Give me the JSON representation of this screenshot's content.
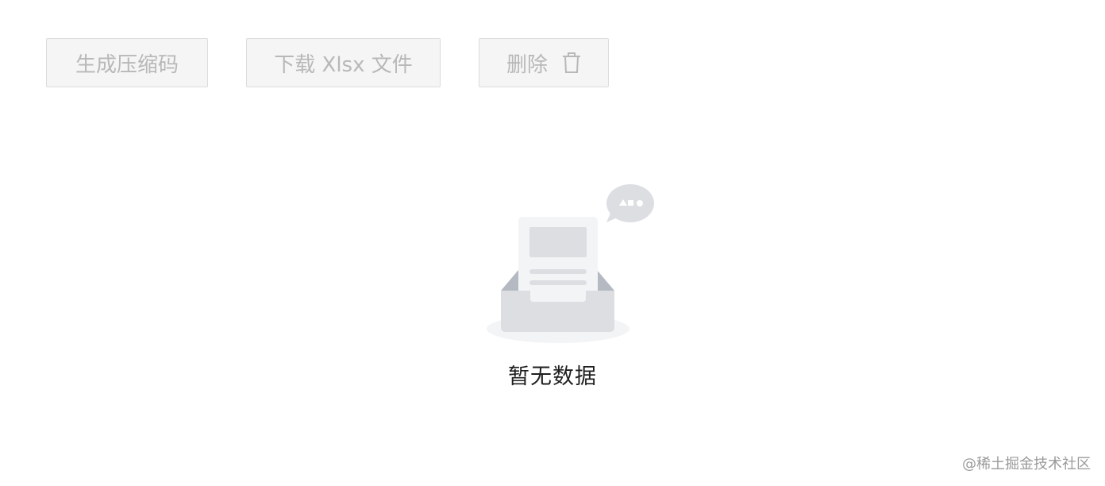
{
  "toolbar": {
    "zip_label": "生成压缩码",
    "xlsx_label": "下载 Xlsx 文件",
    "delete_label": "删除",
    "delete_icon": "trash-icon"
  },
  "empty_state": {
    "text": "暂无数据",
    "illustration": "empty-inbox-illustration"
  },
  "watermark": "@稀土掘金技术社区",
  "colors": {
    "button_bg": "#f5f5f5",
    "button_border": "#dcdcdc",
    "button_text": "#b8b8b8",
    "empty_text": "#1f1f1f"
  }
}
